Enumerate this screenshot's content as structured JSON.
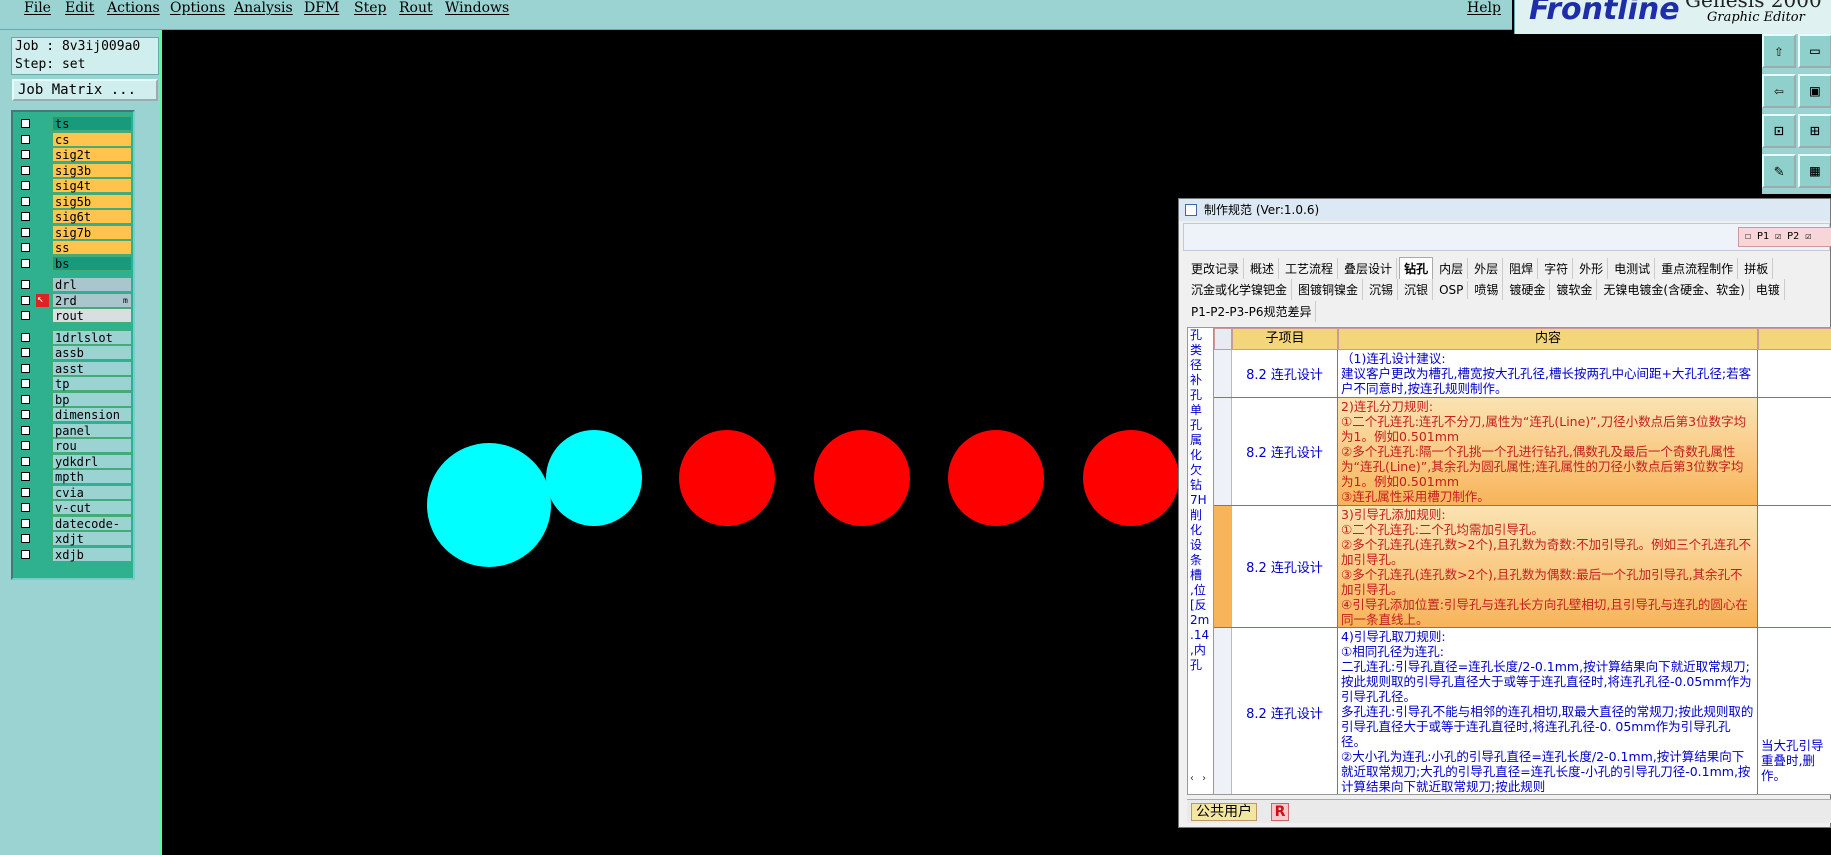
{
  "menubar": {
    "items": [
      "File",
      "Edit",
      "Actions",
      "Options",
      "Analysis",
      "DFM",
      "Step",
      "Rout",
      "Windows"
    ],
    "help": "Help"
  },
  "brand": {
    "logo": "Frontline",
    "sub": "Graphic Editor",
    "top": "Genesis 2000"
  },
  "job": {
    "job_label": "Job : 8v3ij009a0",
    "step_label": "Step: set",
    "matrix_button": "Job Matrix ..."
  },
  "layers": {
    "group1": [
      "ts",
      "cs",
      "sig2t",
      "sig3b",
      "sig4t",
      "sig5b",
      "sig6t",
      "sig7b",
      "ss",
      "bs"
    ],
    "group1_colors": [
      "#179b7c",
      "#ffc44d",
      "#ffc44d",
      "#ffc44d",
      "#ffc44d",
      "#ffc44d",
      "#ffc44d",
      "#ffc44d",
      "#ffc44d",
      "#179b7c"
    ],
    "group2": [
      "drl",
      "2rd",
      "rout"
    ],
    "group2_colors": [
      "#a9c6cc",
      "#a9c6cc",
      "#d9dfe0"
    ],
    "group2_mark": "m",
    "group3": [
      "1drlslot",
      "assb",
      "asst",
      "tp",
      "bp",
      "dimension",
      "panel",
      "rou",
      "ydkdrl",
      "mpth",
      "cvia",
      "v-cut",
      "datecode-bs",
      "xdjt",
      "xdjb"
    ],
    "group3_color": "#9ad3d1"
  },
  "canvas": {
    "circle_colors": {
      "selected": "#00ffff",
      "normal": "#ff0000"
    }
  },
  "dialog": {
    "title": "制作规范 (Ver:1.0.6)",
    "checks": "☐ P1  ☑ P2  ☑",
    "tabs_row1": [
      "更改记录",
      "概述",
      "工艺流程",
      "叠层设计",
      "钻孔",
      "内层",
      "外层",
      "阻焊",
      "字符",
      "外形",
      "电测试",
      "重点流程制作",
      "拼板"
    ],
    "tabs_row1_selected": "钻孔",
    "tabs_row2": [
      "沉金或化学镍钯金",
      "图镀铜镍金",
      "沉锡",
      "沉银",
      "OSP",
      "喷锡",
      "镀硬金",
      "镀软金",
      "无镍电镀金(含硬金、软金)",
      "电镀"
    ],
    "tabs_row3": [
      "P1-P2-P3-P6规范差异"
    ],
    "left_col_text": "孔类\n径补\n孔\n单孔\n属化\n欠钻\n7H削\n化设\n条槽\n,位\n[反\n2m\n.14\n,内\n孔",
    "headers": {
      "sub": "子项目",
      "content": "内容"
    },
    "rows": [
      {
        "sub": "8.2 连孔设计",
        "content": "（1)连孔设计建议:\n建议客户更改为槽孔,槽宽按大孔孔径,槽长按两孔中心间距+大孔孔径;若客户不同意时,按连孔规则制作。",
        "extra": "",
        "style": "plain"
      },
      {
        "sub": "8.2 连孔设计",
        "content": "2)连孔分刀规则:\n①二个孔连孔:连孔不分刀,属性为“连孔(Line)”,刀径小数点后第3位数字均为1。例如0.501mm\n②多个孔连孔:隔一个孔挑一个孔进行钻孔,偶数孔及最后一个奇数孔属性为“连孔(Line)”,其余孔为圆孔属性;连孔属性的刀径小数点后第3位数字均为1。例如0.501mm\n③连孔属性采用槽刀制作。",
        "extra": "",
        "style": "orange"
      },
      {
        "sub": "8.2 连孔设计",
        "content": "3)引导孔添加规则:\n①二个孔连孔:二个孔均需加引导孔。\n②多个孔连孔(连孔数>2个),且孔数为奇数:不加引导孔。例如三个孔连孔不加引导孔。\n③多个孔连孔(连孔数>2个),且孔数为偶数:最后一个孔加引导孔,其余孔不加引导孔。\n④引导孔添加位置:引导孔与连孔长方向孔壁相切,且引导孔与连孔的圆心在同一条直线上。",
        "extra": "",
        "style": "orange"
      },
      {
        "sub": "8.2 连孔设计",
        "content": "4)引导孔取刀规则:\n①相同孔径为连孔:\n二孔连孔:引导孔直径=连孔长度/2-0.1mm,按计算结果向下就近取常规刀;按此规则取的引导孔直径大于或等于连孔直径时,将连孔孔径-0.05mm作为引导孔孔径。\n多孔连孔:引导孔不能与相邻的连孔相切,取最大直径的常规刀;按此规则取的引导孔直径大于或等于连孔直径时,将连孔孔径-0. 05mm作为引导孔孔径。\n②大小孔为连孔:小孔的引导孔直径=连孔长度/2-0.1mm,按计算结果向下就近取常规刀;大孔的引导孔直径=连孔长度-小孔的引导孔刀径-0.1mm,按计算结果向下就近取常规刀;按此规则",
        "extra": "当大孔引导\n重叠时,删\n作。",
        "style": "plain"
      }
    ],
    "status_user": "公共用户",
    "status_r": "R"
  }
}
